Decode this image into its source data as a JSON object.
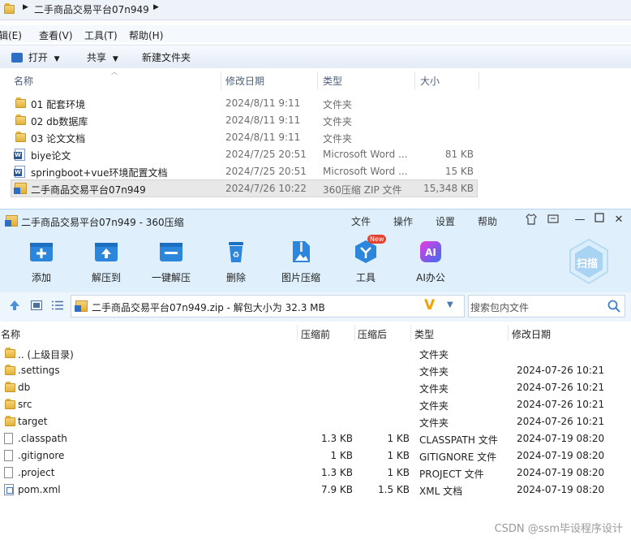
{
  "explorer": {
    "breadcrumb": "二手商品交易平台07n949",
    "menu": [
      "辑(E)",
      "查看(V)",
      "工具(T)",
      "帮助(H)"
    ],
    "toolbar": {
      "open": "打开",
      "share": "共享",
      "new_folder": "新建文件夹"
    },
    "columns": {
      "name": "名称",
      "date": "修改日期",
      "type": "类型",
      "size": "大小"
    },
    "files": [
      {
        "icon": "folder-icon",
        "name": "01 配套环境",
        "date": "2024/8/11 9:11",
        "type": "文件夹",
        "size": ""
      },
      {
        "icon": "folder-icon",
        "name": "02 db数据库",
        "date": "2024/8/11 9:11",
        "type": "文件夹",
        "size": ""
      },
      {
        "icon": "folder-icon",
        "name": "03 论文文档",
        "date": "2024/8/11 9:11",
        "type": "文件夹",
        "size": ""
      },
      {
        "icon": "word-doc-icon",
        "name": "biye论文",
        "date": "2024/7/25 20:51",
        "type": "Microsoft Word ...",
        "size": "81 KB"
      },
      {
        "icon": "word-doc-icon",
        "name": "springboot+vue环境配置文档",
        "date": "2024/7/25 20:51",
        "type": "Microsoft Word ...",
        "size": "15 KB"
      },
      {
        "icon": "zip-archive-icon",
        "name": "二手商品交易平台07n949",
        "date": "2024/7/26 10:22",
        "type": "360压缩 ZIP 文件",
        "size": "15,348 KB",
        "selected": true
      }
    ]
  },
  "zip": {
    "title": "二手商品交易平台07n949 - 360压缩",
    "menu": [
      "文件",
      "操作",
      "设置",
      "帮助"
    ],
    "tools": [
      {
        "label": "添加",
        "icon": "add-icon"
      },
      {
        "label": "解压到",
        "icon": "extract-to-icon"
      },
      {
        "label": "一键解压",
        "icon": "one-click-extract-icon"
      },
      {
        "label": "删除",
        "icon": "delete-icon"
      },
      {
        "label": "图片压缩",
        "icon": "image-compress-icon"
      },
      {
        "label": "工具",
        "icon": "tools-icon",
        "badge": "New"
      },
      {
        "label": "AI办公",
        "icon": "ai-office-icon"
      }
    ],
    "scan_label": "扫描",
    "path_text": "二手商品交易平台07n949.zip - 解包大小为 32.3 MB",
    "search_placeholder": "搜索包内文件",
    "columns": {
      "name": "名称",
      "before": "压缩前",
      "after": "压缩后",
      "type": "类型",
      "date": "修改日期"
    },
    "files": [
      {
        "icon": "folder-icon",
        "name": ".. (上级目录)",
        "before": "",
        "after": "",
        "type": "文件夹",
        "date": ""
      },
      {
        "icon": "folder-icon",
        "name": ".settings",
        "before": "",
        "after": "",
        "type": "文件夹",
        "date": "2024-07-26 10:21"
      },
      {
        "icon": "folder-icon",
        "name": "db",
        "before": "",
        "after": "",
        "type": "文件夹",
        "date": "2024-07-26 10:21"
      },
      {
        "icon": "folder-icon",
        "name": "src",
        "before": "",
        "after": "",
        "type": "文件夹",
        "date": "2024-07-26 10:21"
      },
      {
        "icon": "folder-icon",
        "name": "target",
        "before": "",
        "after": "",
        "type": "文件夹",
        "date": "2024-07-26 10:21"
      },
      {
        "icon": "file-icon",
        "name": ".classpath",
        "before": "1.3 KB",
        "after": "1 KB",
        "type": "CLASSPATH 文件",
        "date": "2024-07-19 08:20"
      },
      {
        "icon": "file-icon",
        "name": ".gitignore",
        "before": "1 KB",
        "after": "1 KB",
        "type": "GITIGNORE 文件",
        "date": "2024-07-19 08:20"
      },
      {
        "icon": "file-icon",
        "name": ".project",
        "before": "1.3 KB",
        "after": "1 KB",
        "type": "PROJECT 文件",
        "date": "2024-07-19 08:20"
      },
      {
        "icon": "xml-file-icon",
        "name": "pom.xml",
        "before": "7.9 KB",
        "after": "1.5 KB",
        "type": "XML 文档",
        "date": "2024-07-19 08:20"
      }
    ]
  },
  "watermark": "CSDN @ssm毕设程序设计",
  "colors": {
    "accent": "#1e88e5",
    "selection": "#e8e8e8",
    "zip_bg": "#dff0fc",
    "orange": "#f0a000"
  }
}
